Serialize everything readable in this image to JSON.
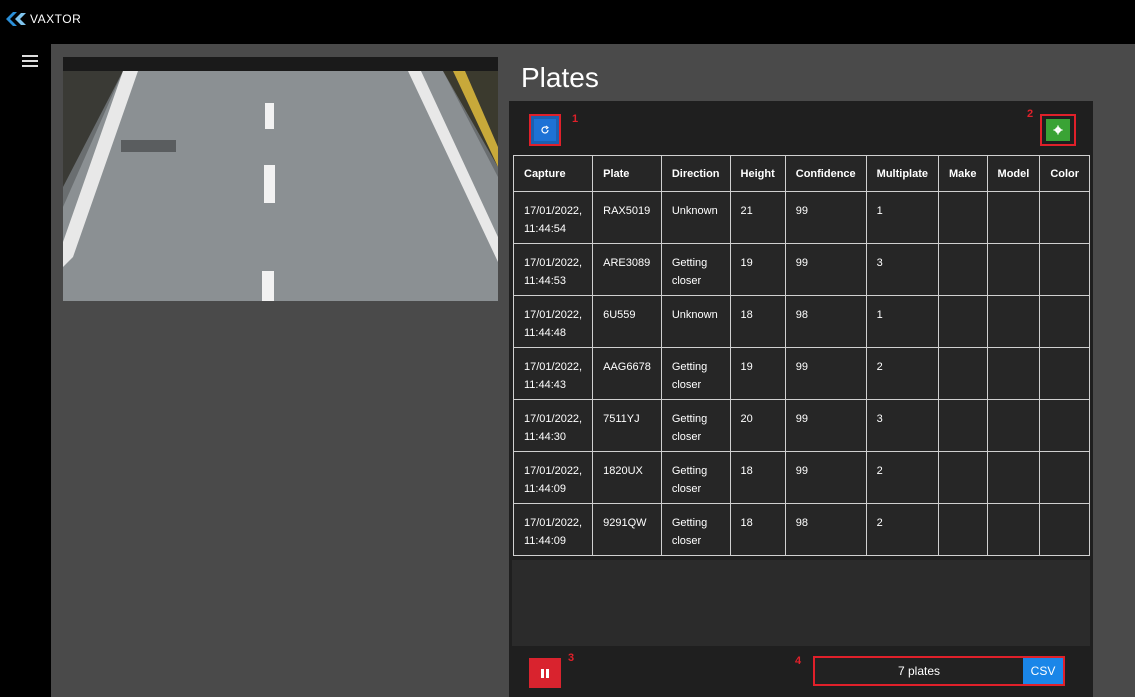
{
  "app": {
    "brand": "VAXTOR"
  },
  "page": {
    "title": "Plates"
  },
  "toolbar": {
    "refresh_icon": "refresh-icon",
    "settings_icon": "gear-icon",
    "pause_icon": "pause-icon",
    "markers": [
      "1",
      "2",
      "3",
      "4"
    ]
  },
  "table": {
    "headers": [
      "Capture",
      "Plate",
      "Direction",
      "Height",
      "Confidence",
      "Multiplate",
      "Make",
      "Model",
      "Color"
    ],
    "rows": [
      [
        "17/01/2022, 11:44:54",
        "RAX5019",
        "Unknown",
        "21",
        "99",
        "1",
        "",
        "",
        ""
      ],
      [
        "17/01/2022, 11:44:53",
        "ARE3089",
        "Getting closer",
        "19",
        "99",
        "3",
        "",
        "",
        ""
      ],
      [
        "17/01/2022, 11:44:48",
        "6U559",
        "Unknown",
        "18",
        "98",
        "1",
        "",
        "",
        ""
      ],
      [
        "17/01/2022, 11:44:43",
        "AAG6678",
        "Getting closer",
        "19",
        "99",
        "2",
        "",
        "",
        ""
      ],
      [
        "17/01/2022, 11:44:30",
        "7511YJ",
        "Getting closer",
        "20",
        "99",
        "3",
        "",
        "",
        ""
      ],
      [
        "17/01/2022, 11:44:09",
        "1820UX",
        "Getting closer",
        "18",
        "99",
        "2",
        "",
        "",
        ""
      ],
      [
        "17/01/2022, 11:44:09",
        "9291QW",
        "Getting closer",
        "18",
        "98",
        "2",
        "",
        "",
        ""
      ]
    ]
  },
  "footer": {
    "count": "7 plates",
    "csv_label": "CSV"
  }
}
